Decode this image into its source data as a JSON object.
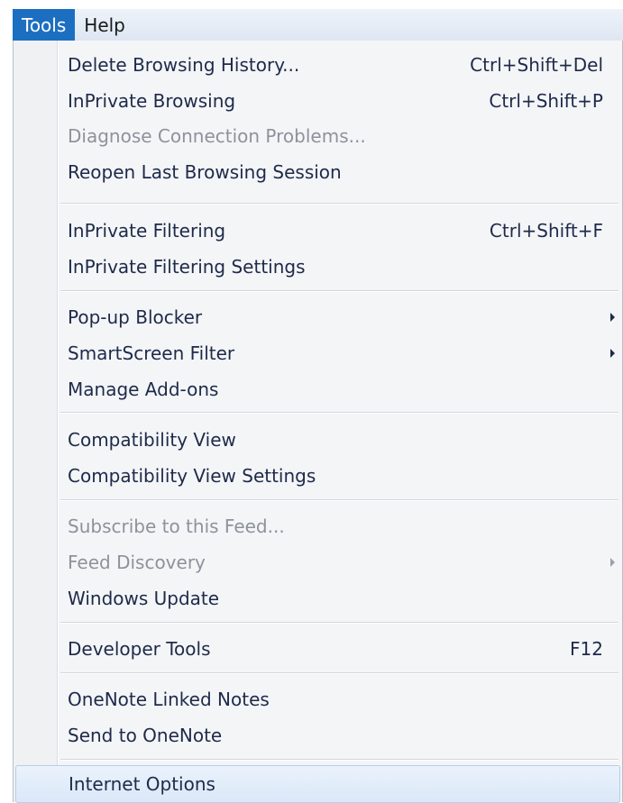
{
  "menubar": {
    "items": [
      {
        "label": "Tools"
      },
      {
        "label": "Help"
      }
    ]
  },
  "tools_menu": {
    "items": [
      {
        "label": "Delete Browsing History...",
        "shortcut": "Ctrl+Shift+Del",
        "enabled": true
      },
      {
        "label": "InPrivate Browsing",
        "shortcut": "Ctrl+Shift+P",
        "enabled": true
      },
      {
        "label": "Diagnose Connection Problems...",
        "shortcut": "",
        "enabled": false
      },
      {
        "label": "Reopen Last Browsing Session",
        "shortcut": "",
        "enabled": true
      },
      {
        "label": "InPrivate Filtering",
        "shortcut": "Ctrl+Shift+F",
        "enabled": true
      },
      {
        "label": "InPrivate Filtering Settings",
        "shortcut": "",
        "enabled": true
      },
      {
        "label": "Pop-up Blocker",
        "shortcut": "",
        "enabled": true,
        "submenu": true
      },
      {
        "label": "SmartScreen Filter",
        "shortcut": "",
        "enabled": true,
        "submenu": true
      },
      {
        "label": "Manage Add-ons",
        "shortcut": "",
        "enabled": true
      },
      {
        "label": "Compatibility View",
        "shortcut": "",
        "enabled": true
      },
      {
        "label": "Compatibility View Settings",
        "shortcut": "",
        "enabled": true
      },
      {
        "label": "Subscribe to this Feed...",
        "shortcut": "",
        "enabled": false
      },
      {
        "label": "Feed Discovery",
        "shortcut": "",
        "enabled": false,
        "submenu": true
      },
      {
        "label": "Windows Update",
        "shortcut": "",
        "enabled": true
      },
      {
        "label": "Developer Tools",
        "shortcut": "F12",
        "enabled": true
      },
      {
        "label": "OneNote Linked Notes",
        "shortcut": "",
        "enabled": true
      },
      {
        "label": "Send to OneNote",
        "shortcut": "",
        "enabled": true
      },
      {
        "label": "Internet Options",
        "shortcut": "",
        "enabled": true,
        "highlighted": true
      }
    ]
  },
  "colors": {
    "menubar_active_bg": "#1c6fc0",
    "menu_text": "#1e2a4a",
    "disabled_text": "#8d929b",
    "highlight_bg": "#dbe8f8"
  }
}
